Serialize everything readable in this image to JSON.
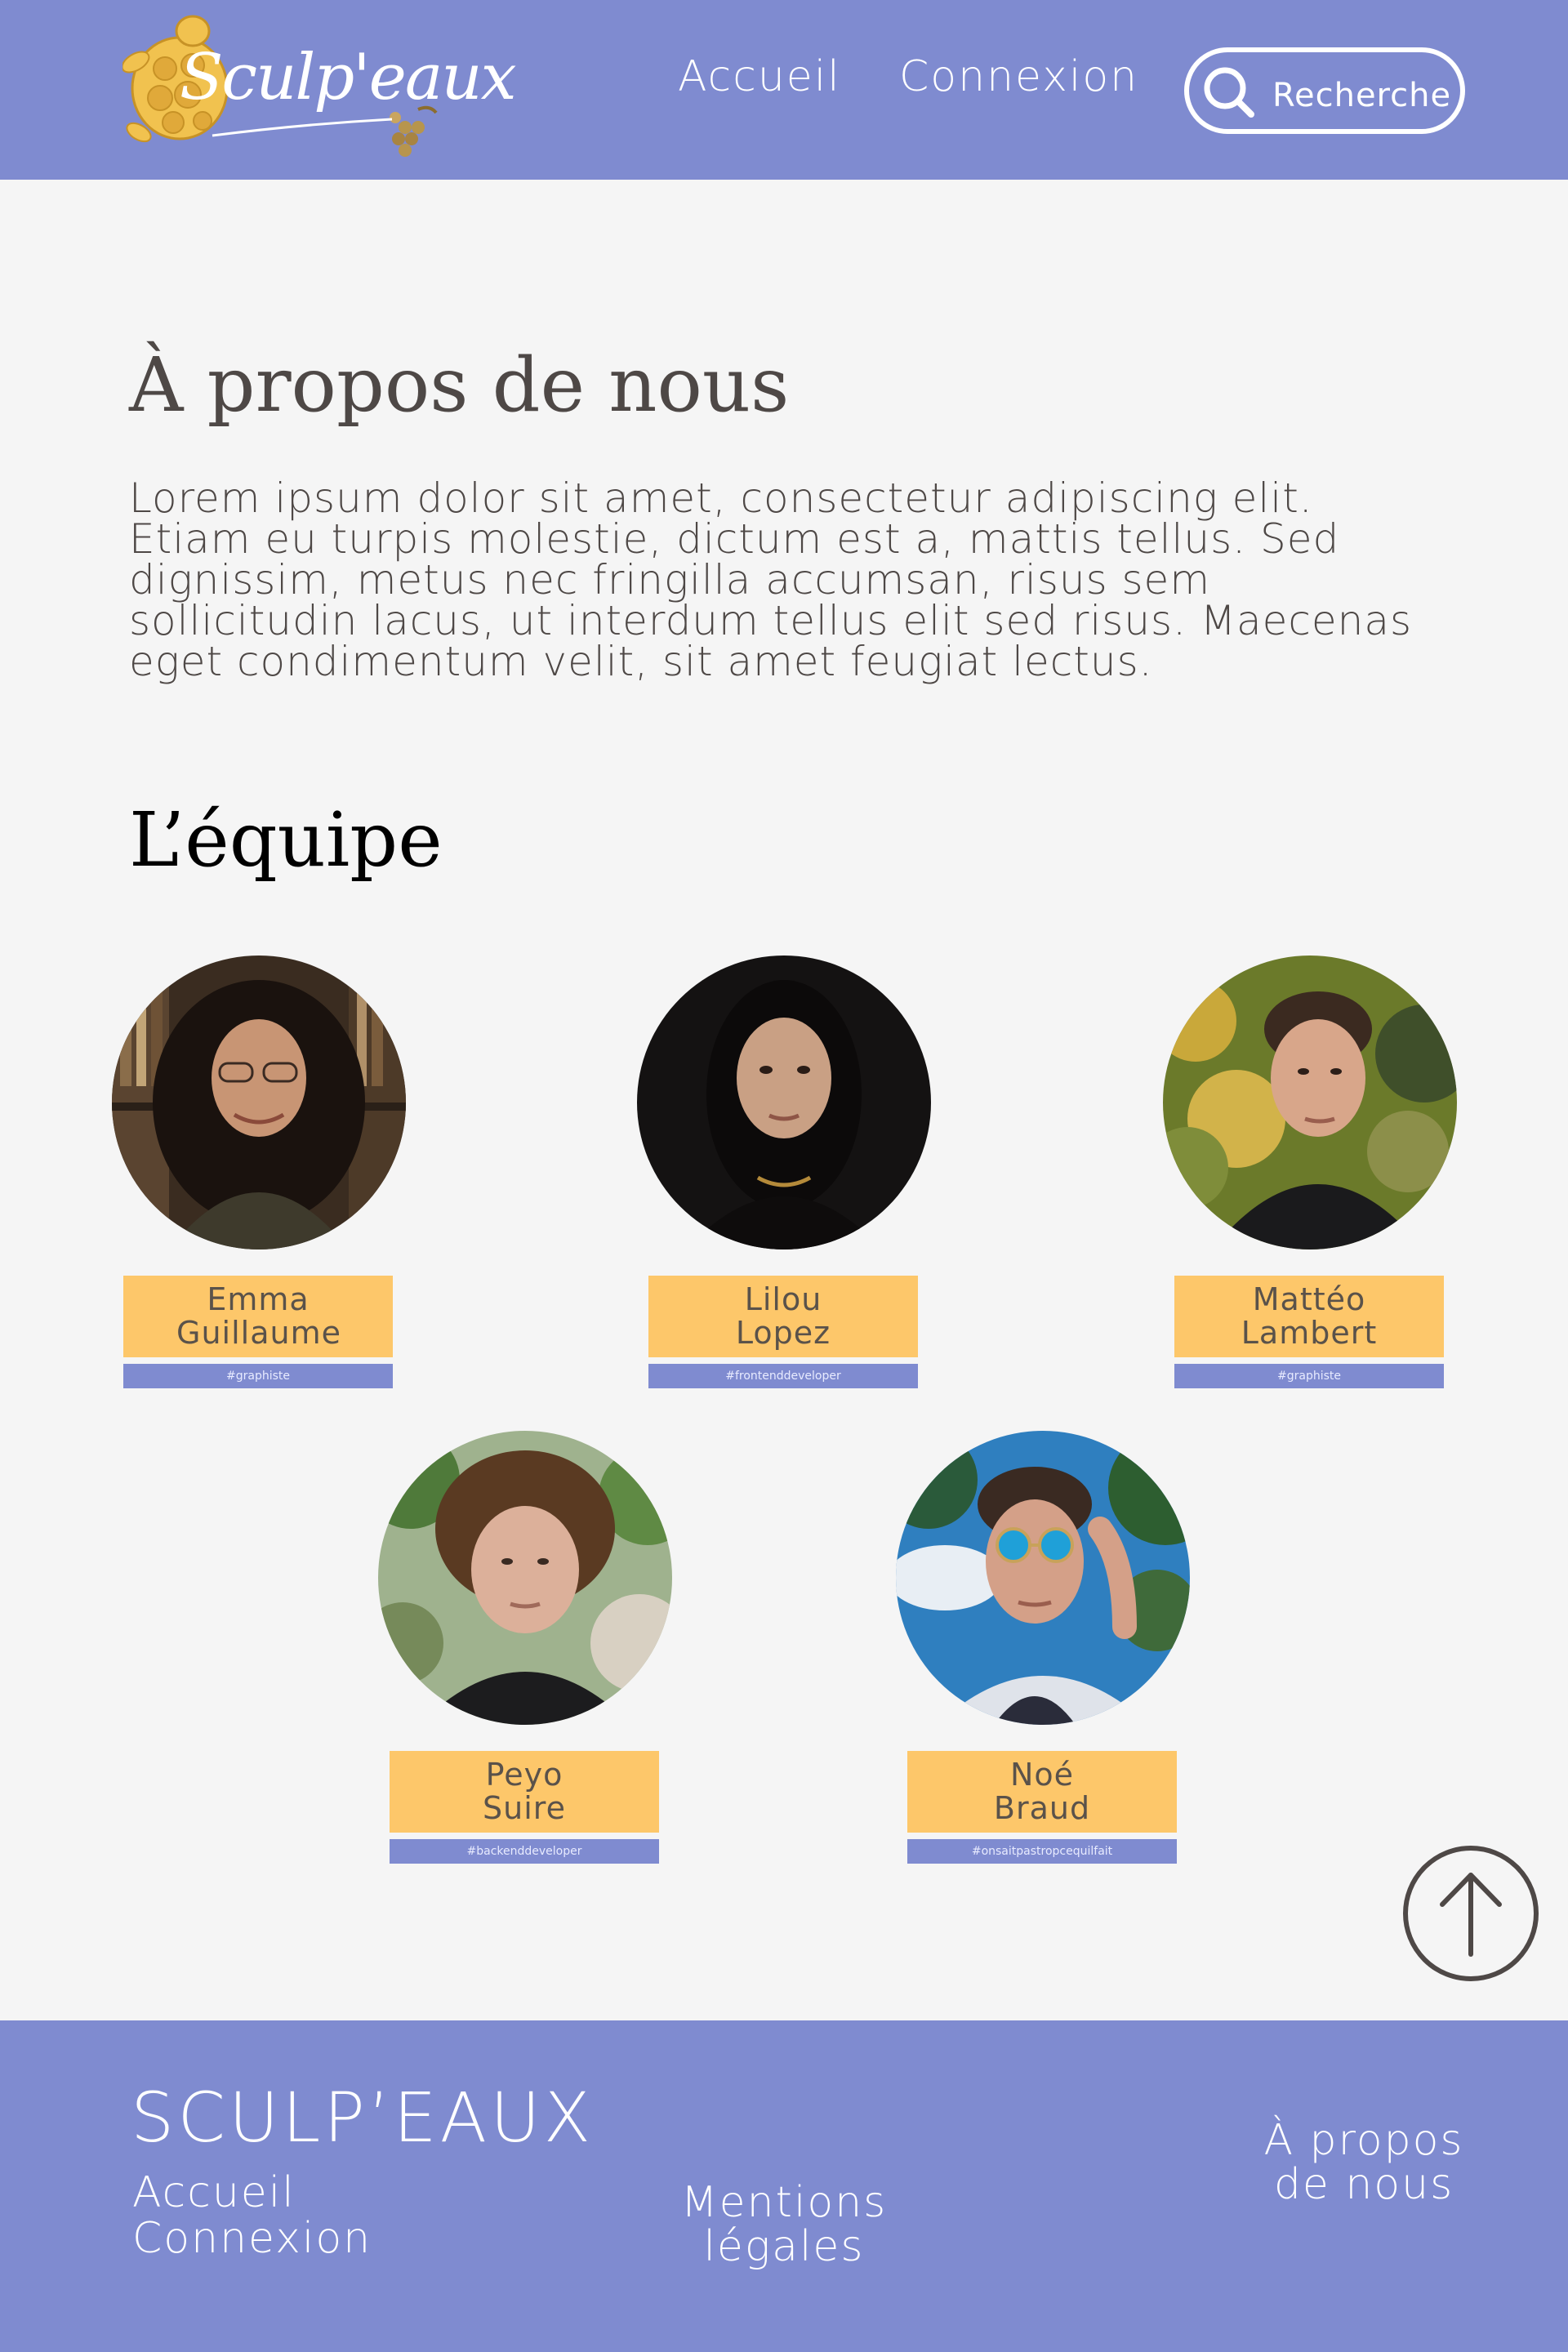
{
  "header": {
    "logo_text": "Sculp'eaux",
    "nav": [
      {
        "label": "Accueil"
      },
      {
        "label": "Connexion"
      }
    ],
    "search": {
      "placeholder": "Recherche"
    }
  },
  "about": {
    "title": "À propos de nous",
    "text": "Lorem ipsum dolor sit amet, consectetur adipiscing elit. Etiam eu turpis molestie, dictum est a, mattis tellus. Sed dignissim, metus nec fringilla accumsan, risus sem sollicitudin lacus, ut interdum tellus elit sed risus. Maecenas eget condimentum velit, sit amet feugiat lectus."
  },
  "team": {
    "title": "L’équipe",
    "members": [
      {
        "name": "Emma Guillaume",
        "tag": "#graphiste"
      },
      {
        "name": "Lilou Lopez",
        "tag": "#frontenddeveloper"
      },
      {
        "name": "Mattéo Lambert",
        "tag": "#graphiste"
      },
      {
        "name": "Peyo Suire",
        "tag": "#backenddeveloper"
      },
      {
        "name": "Noé Braud",
        "tag": "#onsaitpastropcequilfait"
      }
    ]
  },
  "footer": {
    "brand": "SCULP’EAUX",
    "links": {
      "accueil": "Accueil",
      "connexion": "Connexion",
      "mentions": "Mentions légales",
      "apropos": "À propos de nous"
    }
  },
  "colors": {
    "header_bg": "#7f8bd0",
    "page_bg": "#f5f5f5",
    "name_box": "#fdc76a",
    "tag_box": "#7f8bd0",
    "text_dark": "#4e4846"
  },
  "icons": {
    "search": "search-icon",
    "back_to_top": "arrow-up-icon",
    "logo": "turtle-logo-icon"
  }
}
